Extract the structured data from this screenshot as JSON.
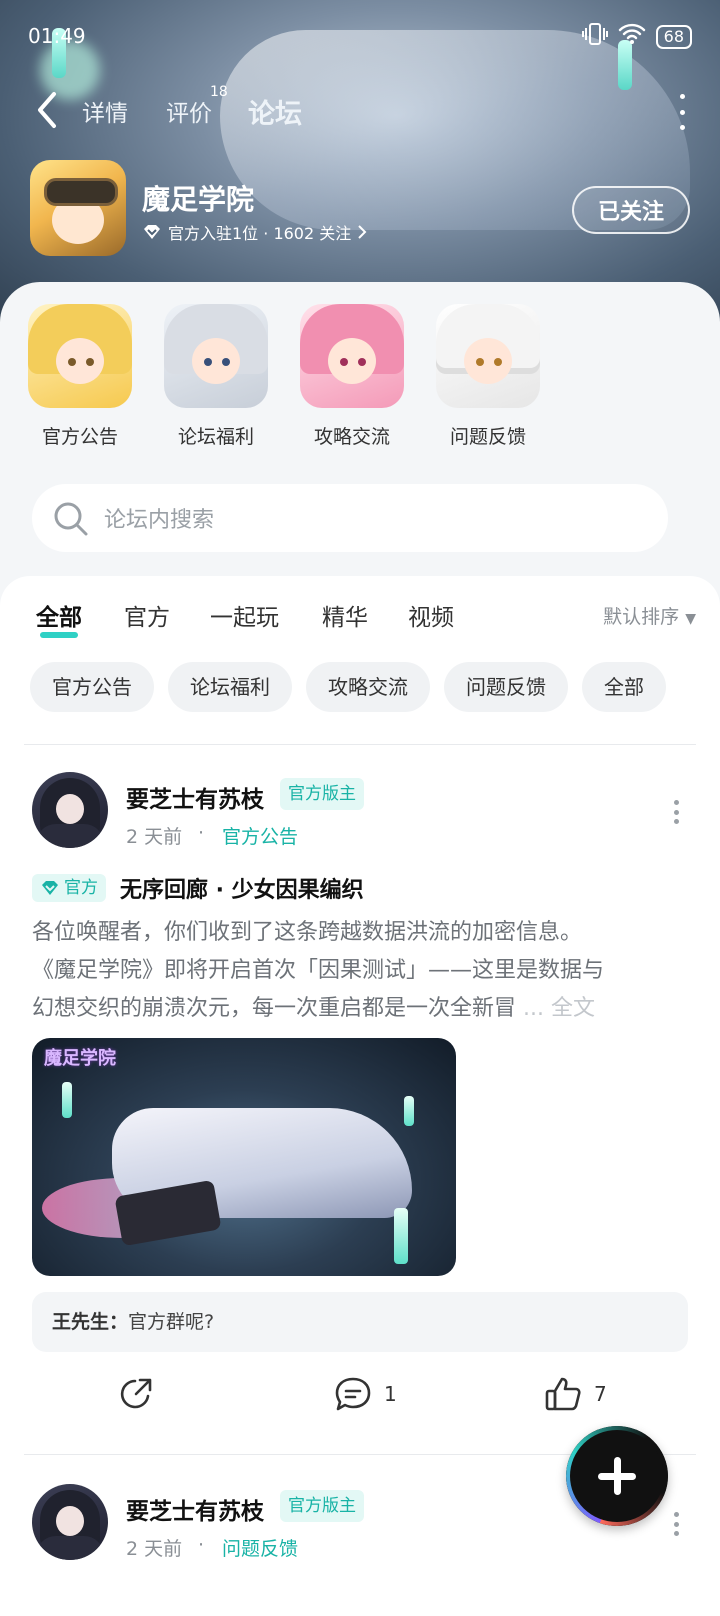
{
  "status": {
    "time": "01:49",
    "battery": "68"
  },
  "nav": {
    "tabs": [
      {
        "label": "详情"
      },
      {
        "label": "评价",
        "badge": "18"
      },
      {
        "label": "论坛"
      }
    ],
    "active_tab": "论坛"
  },
  "game": {
    "name": "魔足学院",
    "meta": "官方入驻1位 · 1602 关注",
    "follow_label": "已关注"
  },
  "categories": [
    {
      "label": "官方公告"
    },
    {
      "label": "论坛福利"
    },
    {
      "label": "攻略交流"
    },
    {
      "label": "问题反馈"
    }
  ],
  "search": {
    "placeholder": "论坛内搜索"
  },
  "feed_tabs": [
    {
      "label": "全部"
    },
    {
      "label": "官方"
    },
    {
      "label": "一起玩"
    },
    {
      "label": "精华"
    },
    {
      "label": "视频"
    }
  ],
  "sort_label": "默认排序",
  "chips": [
    {
      "label": "官方公告"
    },
    {
      "label": "论坛福利"
    },
    {
      "label": "攻略交流"
    },
    {
      "label": "问题反馈"
    },
    {
      "label": "全部"
    }
  ],
  "posts": [
    {
      "author": "要芝士有苏枝",
      "role": "官方版主",
      "time": "2 天前",
      "category": "官方公告",
      "official_tag": "官方",
      "title": "无序回廊 · 少女因果编织",
      "body_lines": [
        "各位唤醒者，你们收到了这条跨越数据洪流的加密信息。",
        "《魔足学院》即将开启首次「因果测试」——这里是数据与",
        "幻想交织的崩溃次元，每一次重启都是一次全新冒"
      ],
      "read_more": "... 全文",
      "image_logo": "魔足学院",
      "reply": {
        "user": "王先生：",
        "text": "官方群呢?"
      },
      "comments": "1",
      "likes": "7"
    },
    {
      "author": "要芝士有苏枝",
      "role": "官方版主",
      "time": "2 天前",
      "category": "问题反馈"
    }
  ]
}
